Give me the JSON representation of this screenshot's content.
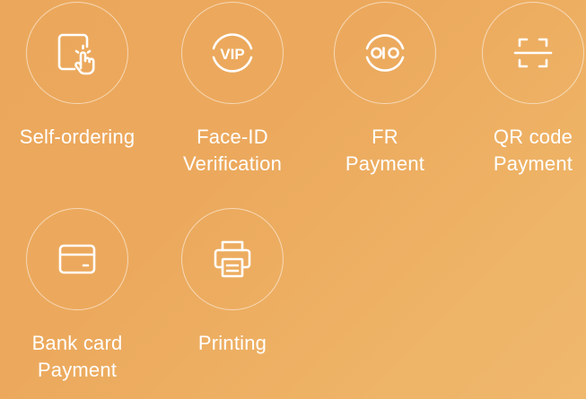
{
  "colors": {
    "background_start": "#eba85c",
    "background_end": "#efb86d",
    "foreground": "#ffffff"
  },
  "features": [
    {
      "icon": "tablet-tap-icon",
      "label_lines": [
        "Self-ordering"
      ]
    },
    {
      "icon": "vip-face-icon",
      "label_lines": [
        "Face-ID",
        "Verification"
      ],
      "icon_text": "VIP"
    },
    {
      "icon": "face-recognition-icon",
      "label_lines": [
        "FR",
        "Payment"
      ]
    },
    {
      "icon": "qr-scan-icon",
      "label_lines": [
        "QR code",
        "Payment"
      ]
    },
    {
      "icon": "bank-card-icon",
      "label_lines": [
        "Bank card",
        "Payment"
      ]
    },
    {
      "icon": "printer-icon",
      "label_lines": [
        "Printing"
      ]
    }
  ]
}
